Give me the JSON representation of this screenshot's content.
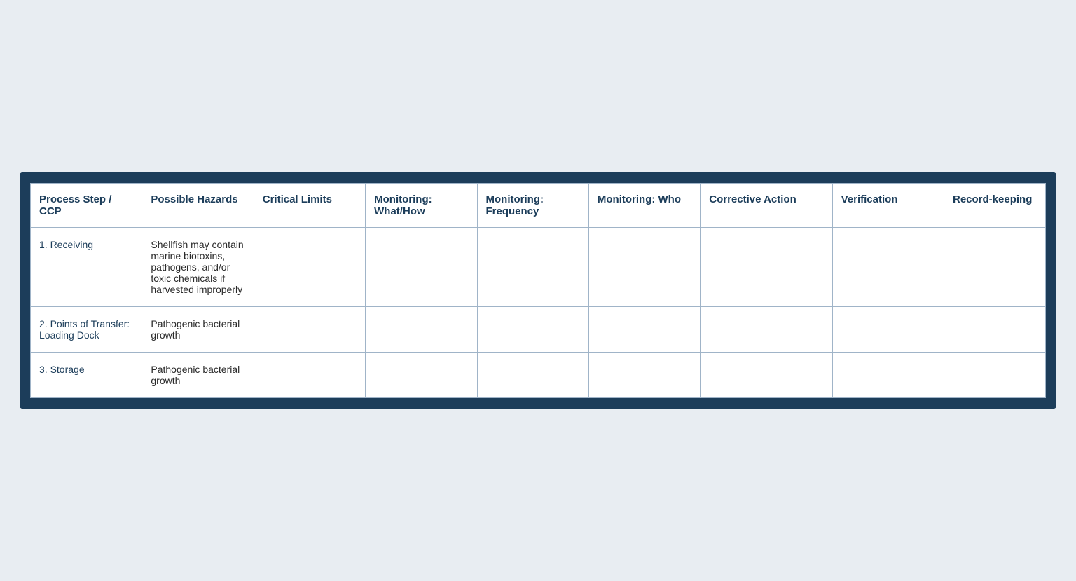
{
  "table": {
    "headers": [
      {
        "id": "process-step",
        "label": "Process Step / CCP"
      },
      {
        "id": "possible-hazards",
        "label": "Possible Hazards"
      },
      {
        "id": "critical-limits",
        "label": "Critical Limits"
      },
      {
        "id": "monitoring-what",
        "label": "Monitoring: What/How"
      },
      {
        "id": "monitoring-frequency",
        "label": "Monitoring: Frequency"
      },
      {
        "id": "monitoring-who",
        "label": "Monitoring: Who"
      },
      {
        "id": "corrective-action",
        "label": "Corrective Action"
      },
      {
        "id": "verification",
        "label": "Verification"
      },
      {
        "id": "recordkeeping",
        "label": "Record-keeping"
      }
    ],
    "rows": [
      {
        "process_step": "1.   Receiving",
        "possible_hazards": "Shellfish may contain marine biotoxins, pathogens, and/or toxic chemicals if harvested improperly",
        "critical_limits": "",
        "monitoring_what": "",
        "monitoring_frequency": "",
        "monitoring_who": "",
        "corrective_action": "",
        "verification": "",
        "recordkeeping": ""
      },
      {
        "process_step": "2.   Points of Transfer: Loading Dock",
        "possible_hazards": "Pathogenic bacterial growth",
        "critical_limits": "",
        "monitoring_what": "",
        "monitoring_frequency": "",
        "monitoring_who": "",
        "corrective_action": "",
        "verification": "",
        "recordkeeping": ""
      },
      {
        "process_step": "3.   Storage",
        "possible_hazards": "Pathogenic bacterial growth",
        "critical_limits": "",
        "monitoring_what": "",
        "monitoring_frequency": "",
        "monitoring_who": "",
        "corrective_action": "",
        "verification": "",
        "recordkeeping": ""
      }
    ]
  }
}
